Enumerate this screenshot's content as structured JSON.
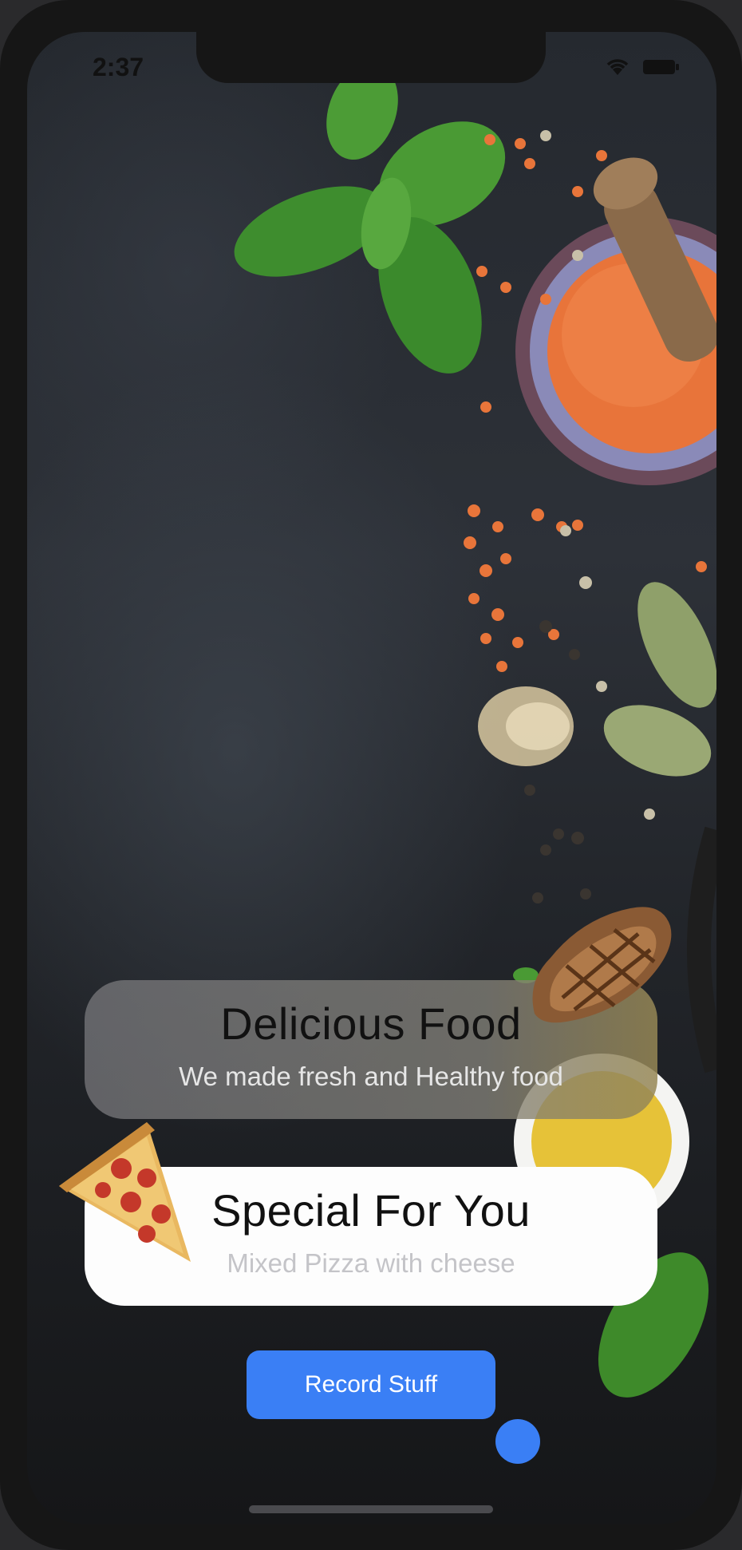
{
  "status_bar": {
    "time": "2:37"
  },
  "cards": [
    {
      "title": "Delicious Food",
      "subtitle": "We made fresh and Healthy food"
    },
    {
      "title": "Special For You",
      "subtitle": "Mixed Pizza with cheese"
    }
  ],
  "record_button": {
    "label": "Record Stuff"
  },
  "colors": {
    "accent": "#3a7ff5",
    "card_light": "#fdfdfd",
    "background": "#25292f"
  },
  "icons": [
    "wifi-icon",
    "battery-icon",
    "steak-image",
    "pizza-slice-image"
  ]
}
